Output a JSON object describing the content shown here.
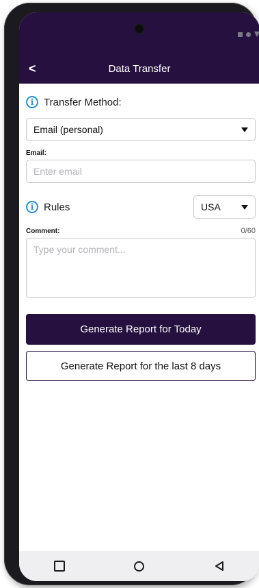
{
  "header": {
    "title": "Data Transfer",
    "back_icon": "<"
  },
  "transfer_method": {
    "info_icon": "i",
    "label": "Transfer Method:",
    "selected": "Email (personal)"
  },
  "email": {
    "label": "Email:",
    "value": "",
    "placeholder": "Enter email"
  },
  "rules": {
    "info_icon": "i",
    "label": "Rules",
    "selected": "USA"
  },
  "comment": {
    "label": "Comment:",
    "counter": "0/60",
    "value": "",
    "placeholder": "Type your comment..."
  },
  "buttons": {
    "today_label": "Generate Report for Today",
    "last_days_label": "Generate Report for the last 8 days"
  },
  "colors": {
    "primary": "#26103f",
    "info": "#2a8fd6",
    "border": "#c7c7cc",
    "placeholder": "#b3b3b8"
  },
  "icons": {
    "status": [
      "square-icon",
      "dot-icon",
      "triangle-icon"
    ],
    "nav": [
      "recent-apps-icon",
      "home-icon",
      "back-nav-icon"
    ]
  }
}
